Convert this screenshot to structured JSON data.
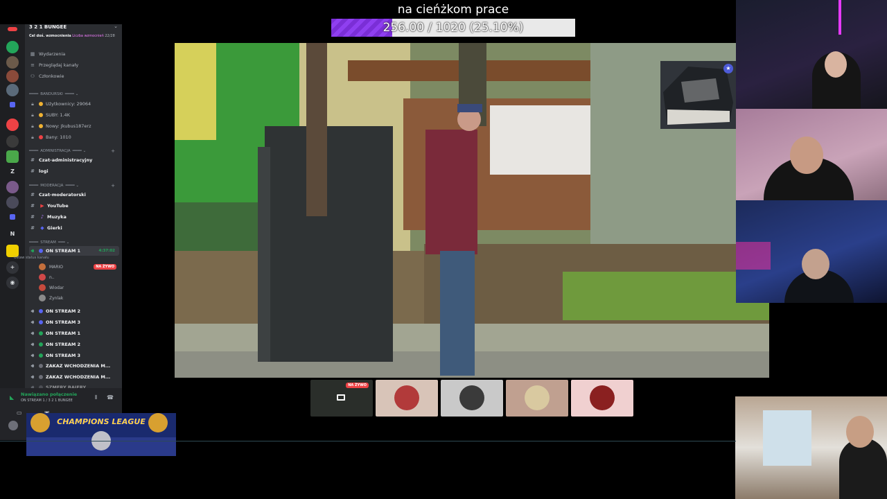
{
  "goal": {
    "title": "na cieńżkom prace",
    "progress_text": "256.00 / 1020 (25.10%)",
    "progress_fraction": 0.251
  },
  "discord": {
    "server_name": "3 2 1 BUNGEE",
    "boost": {
      "label": "Cel doś. wzmocnienia",
      "link": "Liczba wzmocnień",
      "count": "22/28"
    },
    "top_links": [
      {
        "icon": "calendar-icon",
        "label": "Wydarzenia"
      },
      {
        "icon": "browse-icon",
        "label": "Przeglądaj kanały"
      },
      {
        "icon": "members-icon",
        "label": "Członkowie"
      }
    ],
    "category_banduski": "BANDURSKI",
    "stats": [
      {
        "label": "Użytkownicy: 29064",
        "color": "#f0b232"
      },
      {
        "label": "SUBY: 1.4K",
        "color": "#f0b232"
      },
      {
        "label": "Nowy: Jkubus187erz",
        "color": "#f0b232"
      },
      {
        "label": "Bany: 1010",
        "color": "#ed4245"
      }
    ],
    "category_admin": "ADMINISTRACJA",
    "admin_channels": [
      "Czat-administracyjny",
      "logi"
    ],
    "category_mod": "MODERACJA",
    "mod_channels": [
      "Czat-moderatorski",
      "YouTube",
      "Muzyka",
      "Gierki"
    ],
    "category_stream": "STREAM",
    "active_voice": {
      "name": "ON STREAM 1",
      "timer": "4:37:02",
      "status": "Ustaw status kanału"
    },
    "voice_users": [
      {
        "name": "MARIO",
        "live": "NA ŻYWO",
        "color": "#c46f3c"
      },
      {
        "name": "n..",
        "live": "",
        "color": "#d04848"
      },
      {
        "name": "Wiodar",
        "live": "",
        "color": "#c64a3d"
      },
      {
        "name": "Zynlak",
        "live": "",
        "color": "#8a8a8a"
      }
    ],
    "voice_channels": [
      "ON STREAM 2",
      "ON STREAM 3",
      "ON STREAM 1",
      "ON STREAM 2",
      "ON STREAM 3",
      "ZAKAZ WCHODZENIA M...",
      "ZAKAZ WCHODZENIA M...",
      "SZMERY BAJERY"
    ],
    "connection": {
      "status": "Nawiązano połączenie",
      "channel": "ON STREAM 1 / 3 2 1 BUNGEE"
    }
  },
  "tiles": [
    {
      "type": "screen",
      "live": "NA ŻYWO",
      "bg": "#2a2e2a"
    },
    {
      "type": "avatar",
      "bg": "#d8c4b8",
      "avatar": "#b23a3a"
    },
    {
      "type": "avatar",
      "bg": "#c9c9c9",
      "avatar": "#3a3a3a"
    },
    {
      "type": "avatar",
      "bg": "#c0a090",
      "avatar": "#d9c9a0"
    },
    {
      "type": "avatar",
      "bg": "#f0d0d0",
      "avatar": "#8a2020"
    }
  ],
  "banner": {
    "text": "CHAMPIONS LEAGUE"
  },
  "colors": {
    "accent": "#8f3ff0",
    "discord_bg": "#2b2d31",
    "live_red": "#ed4245",
    "online_green": "#23a55a"
  }
}
